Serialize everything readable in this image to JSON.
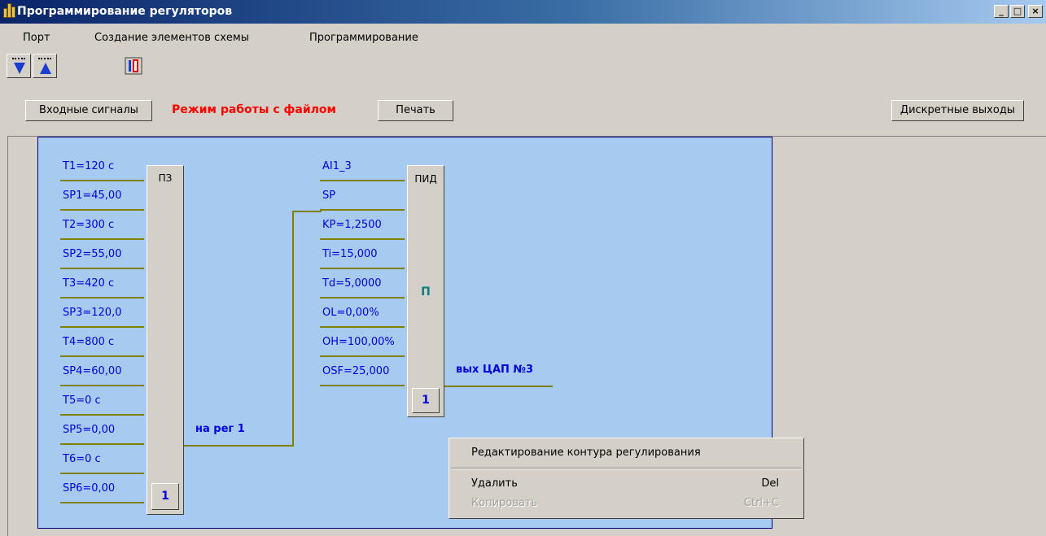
{
  "window": {
    "title": "Программирование регуляторов",
    "controls": [
      "_",
      "□",
      "×"
    ]
  },
  "menu": [
    "Порт",
    "Создание элементов схемы",
    "Программирование"
  ],
  "toolbar": {
    "icons": [
      "download-icon",
      "upload-icon",
      "scheme-icon"
    ]
  },
  "buttons": {
    "inputs": "Входные сигналы",
    "mode": "Режим работы с файлом",
    "print": "Печать",
    "discrete": "Дискретные выходы"
  },
  "pz_block": {
    "title": "ПЗ",
    "number": "1",
    "params": [
      "T1=120 c",
      "SP1=45,00",
      "T2=300 c",
      "SP2=55,00",
      "T3=420 c",
      "SP3=120,0",
      "T4=800 c",
      "SP4=60,00",
      "T5=0 c",
      "SP5=0,00",
      "T6=0 c",
      "SP6=0,00"
    ],
    "output_label": "на рег 1"
  },
  "pid_block": {
    "title": "ПИД",
    "mode": "П",
    "number": "1",
    "params": [
      "AI1_3",
      "SP",
      "KP=1,2500",
      "Ti=15,000",
      "Td=5,0000",
      "OL=0,00%",
      "OH=100,00%",
      "OSF=25,000"
    ],
    "output_label": "вых ЦАП №3"
  },
  "context_menu": {
    "edit": "Редактирование контура регулирования",
    "delete": "Удалить",
    "delete_shortcut": "Del",
    "copy": "Копировать",
    "copy_shortcut": "Ctrl+C"
  }
}
